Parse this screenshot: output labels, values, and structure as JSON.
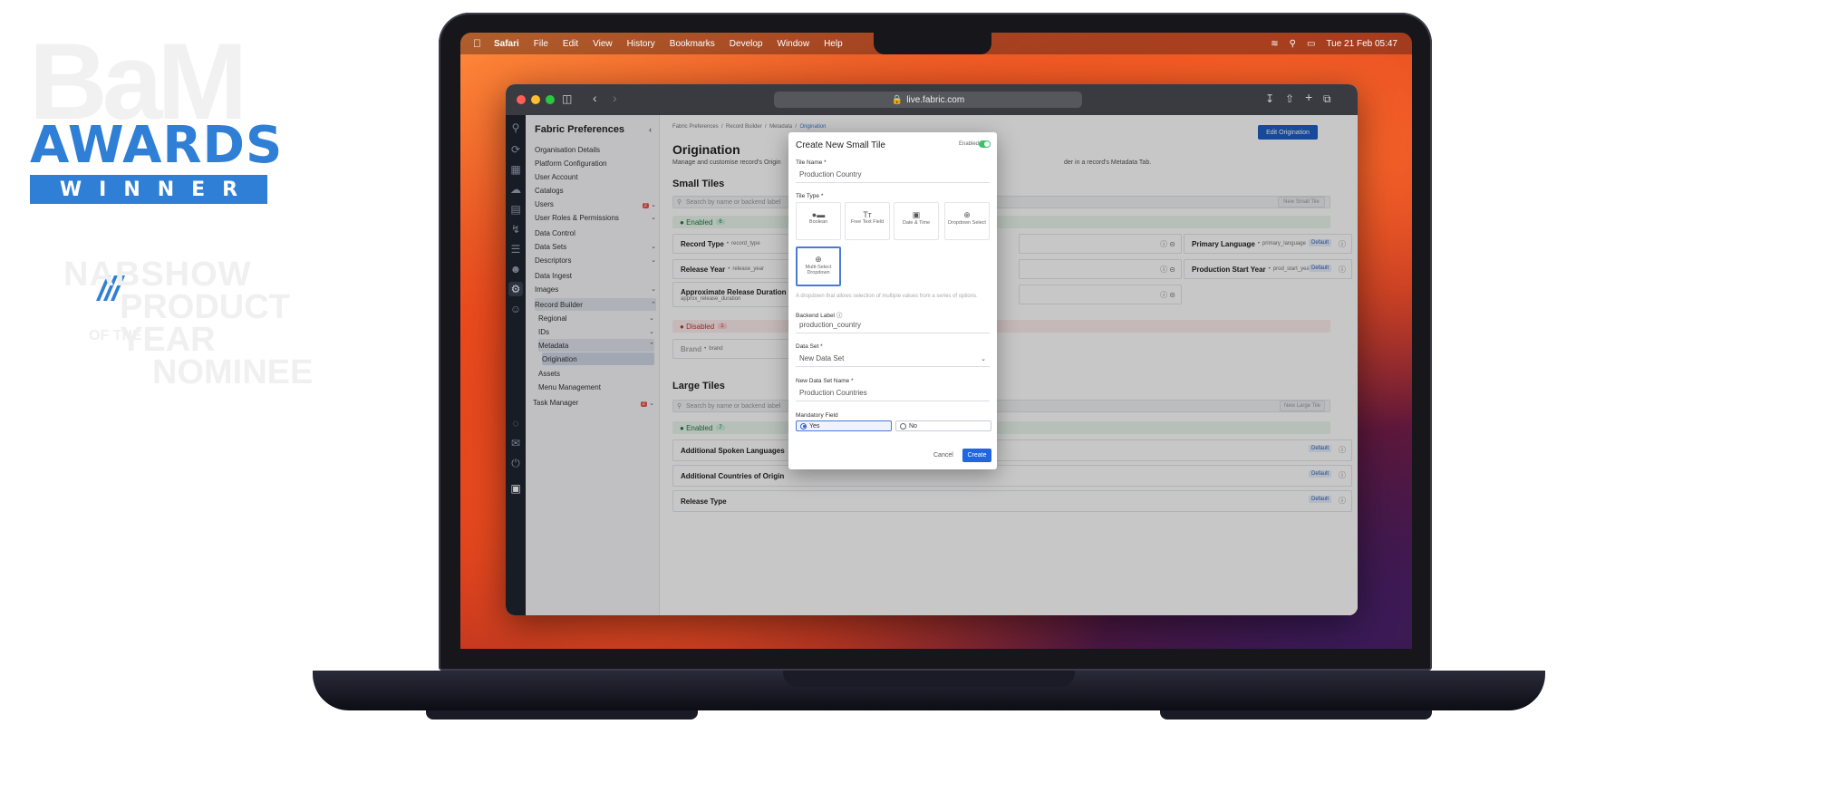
{
  "badges": {
    "bam_text": "BaM",
    "awards_text": "AWARDS",
    "winner_text": "WINNER",
    "nab_lines": [
      "NABSHOW",
      "PRODUCT",
      "YEAR",
      "NOMINEE"
    ],
    "nab_the": "OF THE",
    "accent": "#2f7fd6"
  },
  "menubar": {
    "app": "Safari",
    "items": [
      "File",
      "Edit",
      "View",
      "History",
      "Bookmarks",
      "Develop",
      "Window",
      "Help"
    ],
    "datetime": "Tue 21 Feb 05:47"
  },
  "browser": {
    "url": "live.fabric.com"
  },
  "sidebar": {
    "title": "Fabric Preferences",
    "items": [
      {
        "label": "Organisation Details"
      },
      {
        "label": "Platform Configuration"
      },
      {
        "label": "User Account"
      },
      {
        "label": "Catalogs"
      },
      {
        "label": "Users",
        "badge": "2"
      },
      {
        "label": "User Roles & Permissions"
      },
      {
        "label": "Data Control"
      },
      {
        "label": "Data Sets"
      },
      {
        "label": "Descriptors"
      },
      {
        "label": "Data Ingest"
      },
      {
        "label": "Images"
      },
      {
        "label": "Record Builder"
      },
      {
        "label": "Regional"
      },
      {
        "label": "IDs"
      },
      {
        "label": "Metadata"
      },
      {
        "label": "Origination"
      },
      {
        "label": "Assets"
      },
      {
        "label": "Menu Management"
      },
      {
        "label": "Task Manager",
        "badge": "2"
      }
    ]
  },
  "main": {
    "breadcrumb": [
      "Fabric Preferences",
      "Record Builder",
      "Metadata",
      "Origination"
    ],
    "edit_button": "Edit Origination",
    "title": "Origination",
    "description": "Manage and customise record's Origin",
    "description_tail": "der in a record's Metadata Tab.",
    "small_tiles": {
      "heading": "Small Tiles",
      "search_placeholder": "Search by name or backend label",
      "new_button": "New Small Tile",
      "enabled_label": "Enabled",
      "enabled_count": "6",
      "disabled_label": "Disabled",
      "disabled_count": "1",
      "tiles_left": [
        {
          "name": "Record Type",
          "key": "record_type"
        },
        {
          "name": "Release Year",
          "key": "release_year"
        },
        {
          "name": "Approximate Release Duration",
          "key": "approx_release_duration"
        }
      ],
      "tiles_right": [
        {
          "name": "Primary Language",
          "key": "primary_language",
          "tag": "Default"
        },
        {
          "name": "Production Start Year",
          "key": "prod_start_year",
          "tag": "Default"
        }
      ],
      "disabled_tile": {
        "name": "Brand",
        "key": "brand"
      }
    },
    "large_tiles": {
      "heading": "Large Tiles",
      "search_placeholder": "Search by name or backend label",
      "new_button": "New Large Tile",
      "enabled_label": "Enabled",
      "enabled_count": "7",
      "tiles": [
        {
          "name": "Additional Spoken Languages",
          "tag": "Default"
        },
        {
          "name": "Additional Countries of Origin",
          "tag": "Default"
        },
        {
          "name": "Release Type",
          "tag": "Default"
        }
      ]
    }
  },
  "modal": {
    "title": "Create New Small Tile",
    "enabled_label": "Enabled",
    "tile_name_label": "Tile Name *",
    "tile_name_value": "Production Country",
    "tile_type_label": "Tile Type *",
    "types": [
      {
        "label": "Boolean",
        "icon": "toggle-icon"
      },
      {
        "label": "Free Text Field",
        "icon": "text-icon"
      },
      {
        "label": "Date & Time",
        "icon": "calendar-icon"
      },
      {
        "label": "Dropdown Select",
        "icon": "dropdown-icon"
      },
      {
        "label": "Multi-Select Dropdown",
        "icon": "multiselect-icon",
        "selected": true
      }
    ],
    "type_hint": "A dropdown that allows selection of multiple values from a series of options.",
    "backend_label": "Backend Label",
    "backend_value": "production_country",
    "data_set_label": "Data Set *",
    "data_set_value": "New Data Set",
    "new_data_set_label": "New Data Set Name *",
    "new_data_set_value": "Production Countries",
    "mandatory_label": "Mandatory Field",
    "yes": "Yes",
    "no": "No",
    "cancel": "Cancel",
    "create": "Create"
  }
}
